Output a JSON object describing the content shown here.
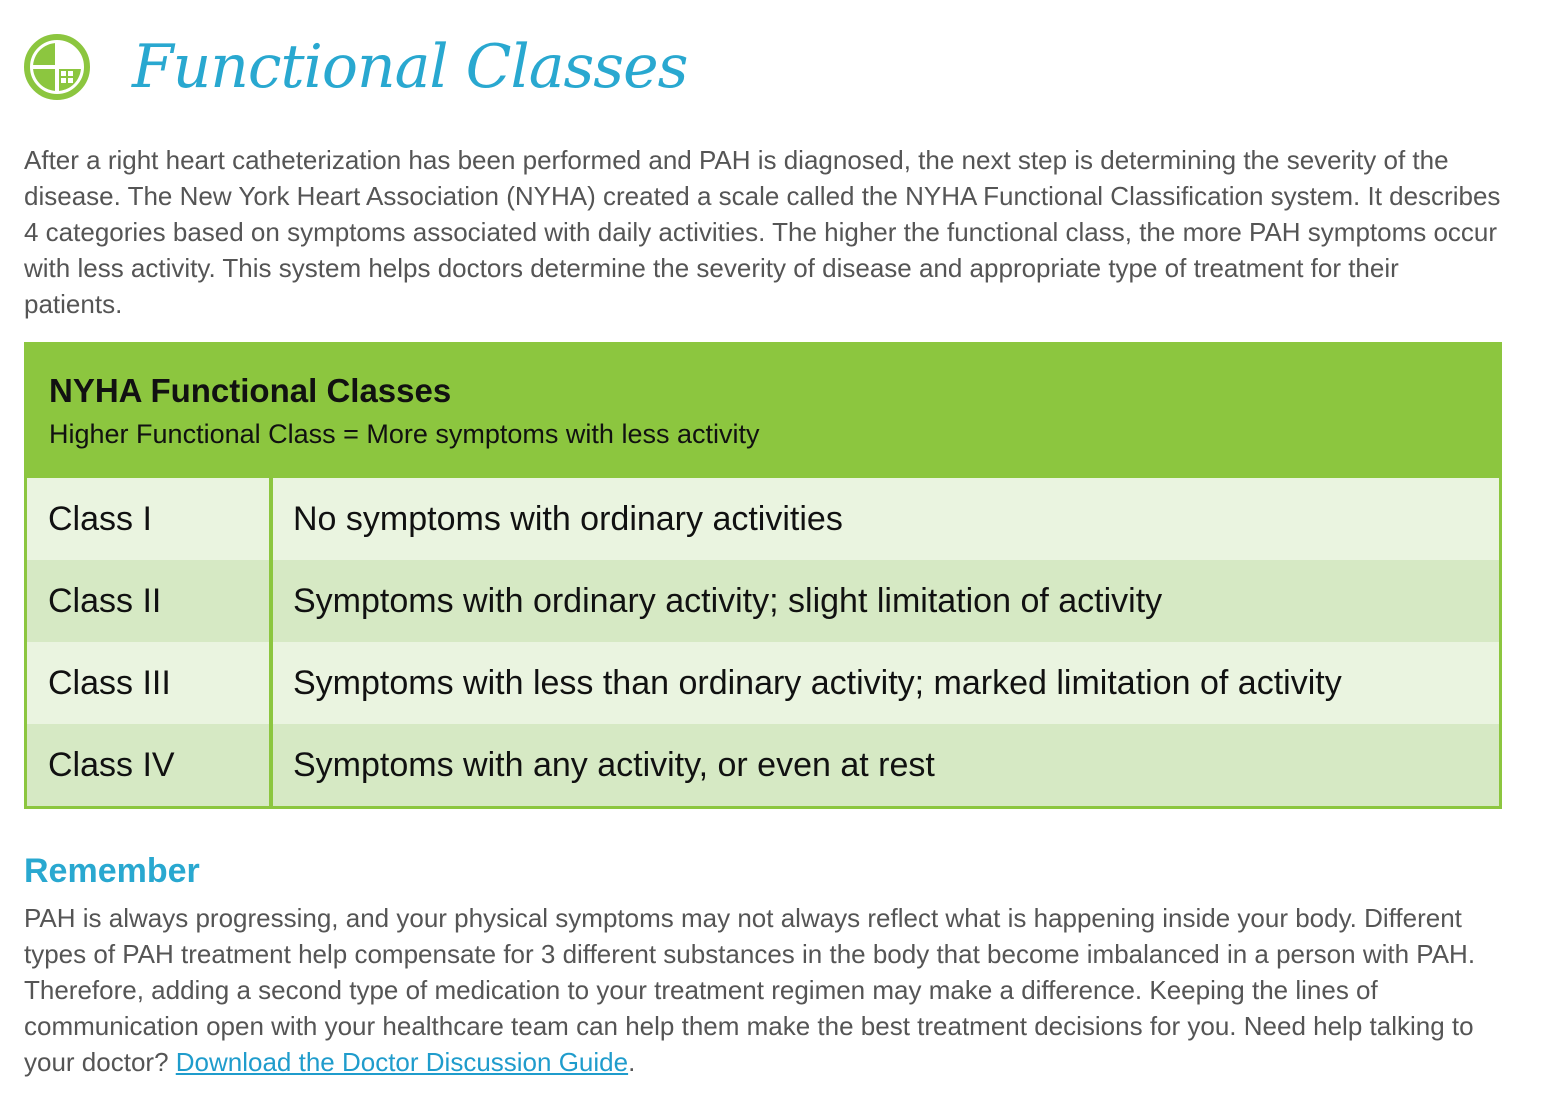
{
  "header": {
    "logo_icon": "functional-classes-logo-icon",
    "title": "Functional Classes"
  },
  "intro": {
    "text": "After a right heart catheterization has been performed and PAH is diagnosed, the next step is determining the severity of the disease. The New York Heart Association (NYHA) created a scale called the NYHA Functional Classification system. It describes 4 categories based on symptoms associated with daily activities. The higher the functional class, the more PAH symptoms occur with less activity. This system helps doctors determine the severity of disease and appropriate type of treatment for their patients."
  },
  "table": {
    "title": "NYHA Functional Classes",
    "subtitle": "Higher Functional Class = More symptoms with less activity",
    "rows": [
      {
        "class_name": "Class I",
        "description": "No symptoms with ordinary activities"
      },
      {
        "class_name": "Class II",
        "description": "Symptoms with ordinary activity; slight limitation of activity"
      },
      {
        "class_name": "Class III",
        "description": "Symptoms with less than ordinary activity; marked limitation of activity"
      },
      {
        "class_name": "Class IV",
        "description": "Symptoms with any activity, or even at rest"
      }
    ]
  },
  "remember": {
    "heading": "Remember",
    "text": "PAH is always progressing, and your physical symptoms may not always reflect what is happening inside your body. Different types of PAH treatment help compensate for 3 different substances in the body that become imbalanced in a person with PAH. Therefore, adding a second type of medication to your treatment regimen may make a difference. Keeping the lines of communication open with your healthcare team can help them make the best treatment decisions for you. Need help talking to your doctor? ",
    "link_text": "Download the Doctor Discussion Guide",
    "trailing": "."
  },
  "colors": {
    "accent_blue": "#29a8d0",
    "table_green": "#8cc63f",
    "row_light": "#eaf4e0",
    "row_dark": "#d6e9c4",
    "body_text": "#555555"
  }
}
